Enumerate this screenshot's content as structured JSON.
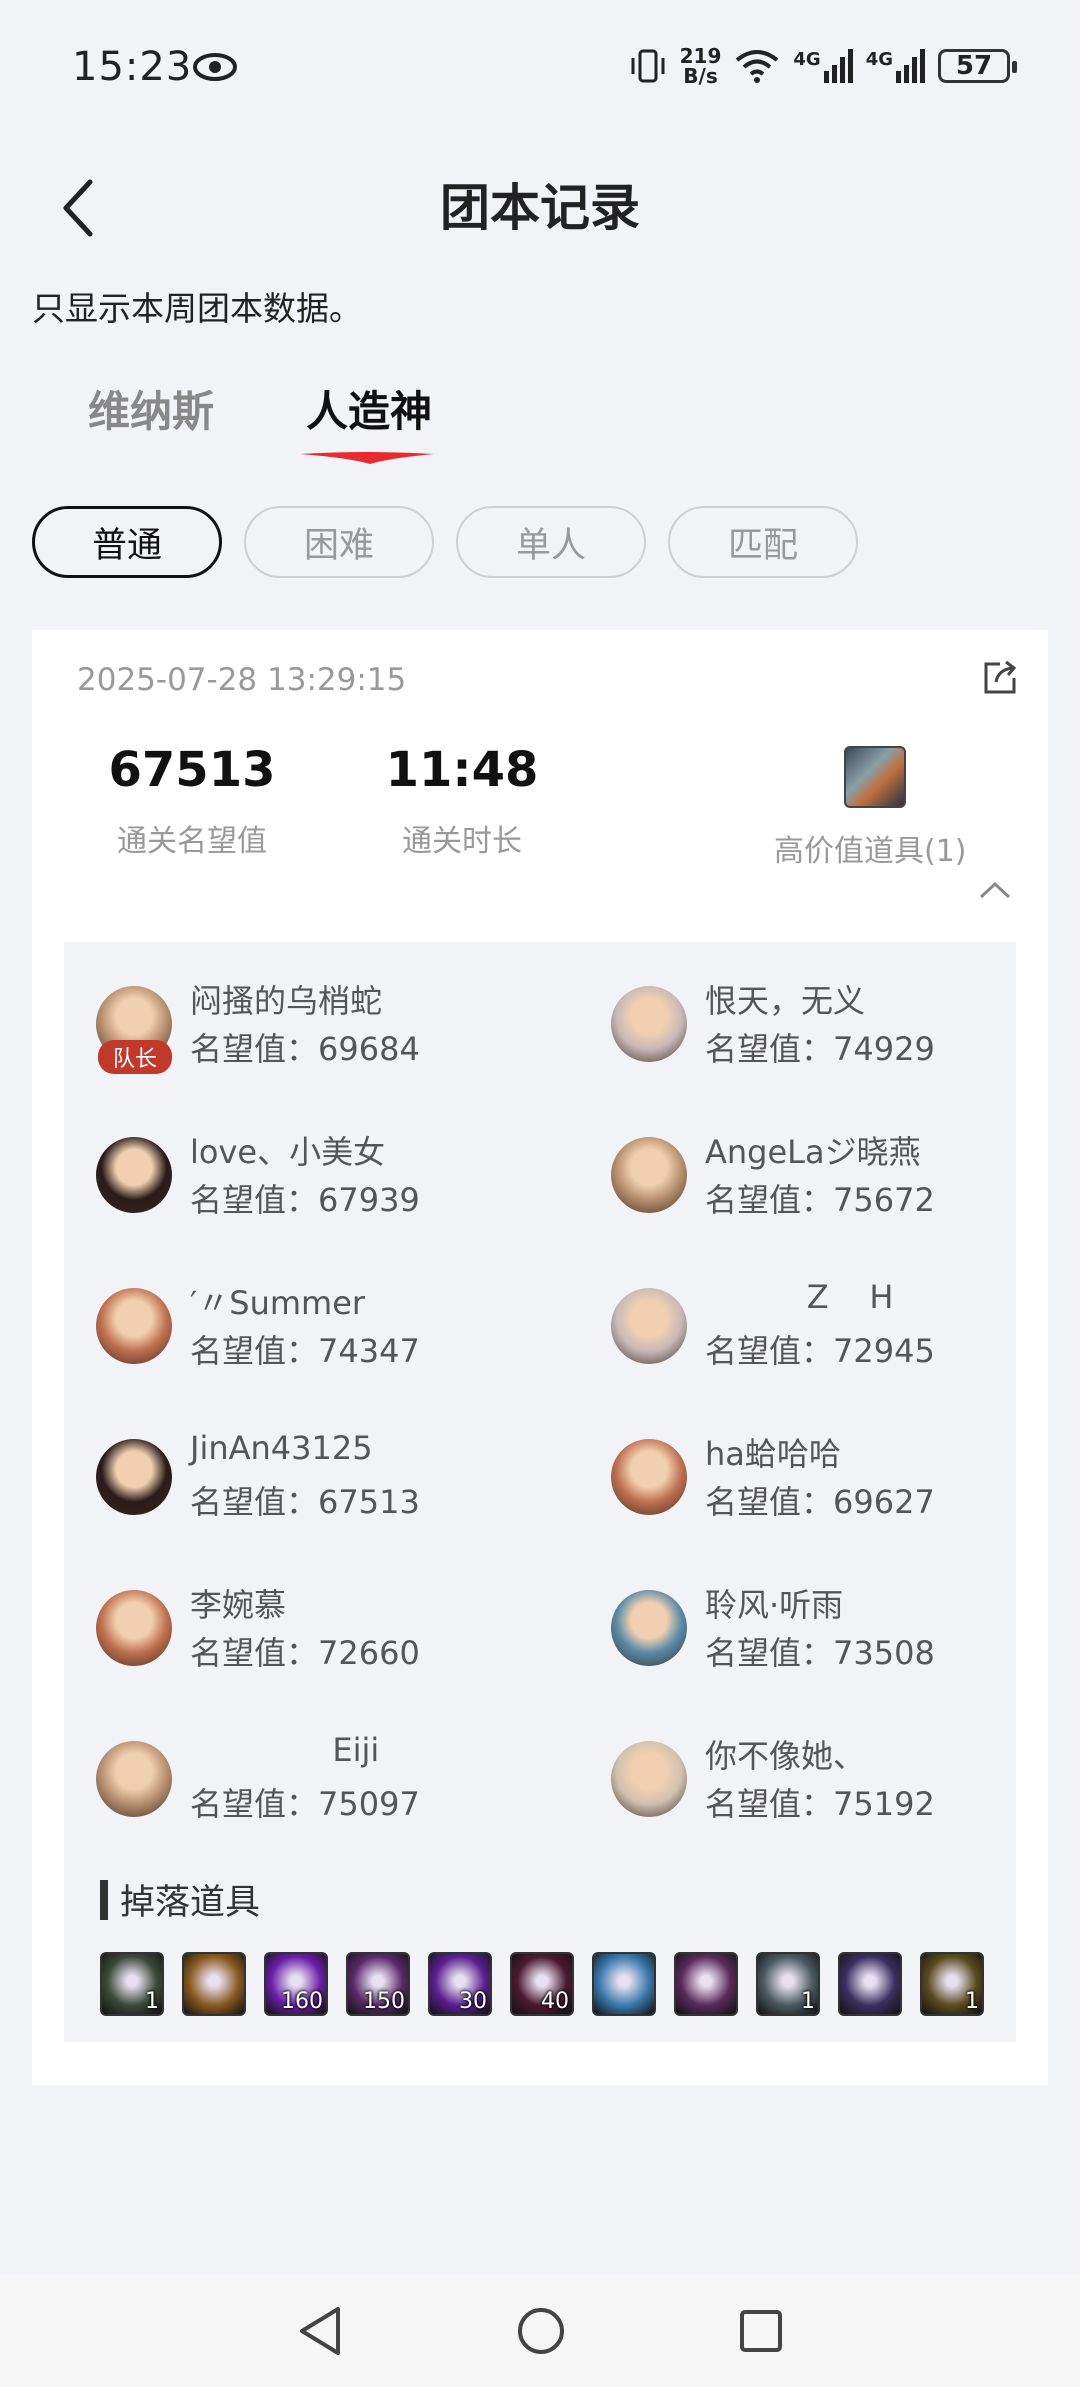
{
  "status_bar": {
    "time": "15:23",
    "net_speed_value": "219",
    "net_speed_unit": "B/s",
    "signal_1": "4G",
    "signal_2": "4G",
    "battery": "57"
  },
  "header": {
    "title": "团本记录"
  },
  "notice": "只显示本周团本数据。",
  "tabs": [
    {
      "label": "维纳斯",
      "active": false
    },
    {
      "label": "人造神",
      "active": true
    }
  ],
  "filters": [
    {
      "label": "普通",
      "active": true
    },
    {
      "label": "困难",
      "active": false
    },
    {
      "label": "单人",
      "active": false
    },
    {
      "label": "匹配",
      "active": false
    }
  ],
  "record": {
    "datetime": "2025-07-28 13:29:15",
    "reputation": "67513",
    "reputation_label": "通关名望值",
    "duration": "11:48",
    "duration_label": "通关时长",
    "high_value_label": "高价值道具(1)",
    "captain_badge": "队长",
    "members": [
      {
        "name": "闷搔的乌梢蛇",
        "score": "名望值：69684"
      },
      {
        "name": "恨天，无义",
        "score": "名望值：74929"
      },
      {
        "name": "love、小美女",
        "score": "名望值：67939"
      },
      {
        "name": "AngeLaジ晓燕",
        "score": "名望值：75672"
      },
      {
        "name": "′〃Summer",
        "score": "名望值：74347"
      },
      {
        "name": "          Z    H",
        "score": "名望值：72945"
      },
      {
        "name": "JinAn43125",
        "score": "名望值：67513"
      },
      {
        "name": "ha蛤哈哈",
        "score": "名望值：69627"
      },
      {
        "name": "李婉慕",
        "score": "名望值：72660"
      },
      {
        "name": "聆风·听雨",
        "score": "名望值：73508"
      },
      {
        "name": "              Eiji",
        "score": "名望值：75097"
      },
      {
        "name": "你不像她、",
        "score": "名望值：75192"
      }
    ],
    "drops_title": "掉落道具",
    "drops": [
      {
        "count": "1",
        "color": "#3d4a3a"
      },
      {
        "count": "",
        "color": "#8a5a20"
      },
      {
        "count": "160",
        "color": "#6a1fa8"
      },
      {
        "count": "150",
        "color": "#5a2a6a"
      },
      {
        "count": "30",
        "color": "#5a2090"
      },
      {
        "count": "40",
        "color": "#4a1a30"
      },
      {
        "count": "",
        "color": "#3a7ab0"
      },
      {
        "count": "",
        "color": "#5a2a5a"
      },
      {
        "count": "1",
        "color": "#4a5a60"
      },
      {
        "count": "",
        "color": "#3a3060"
      },
      {
        "count": "1",
        "color": "#5a4a20"
      }
    ]
  }
}
